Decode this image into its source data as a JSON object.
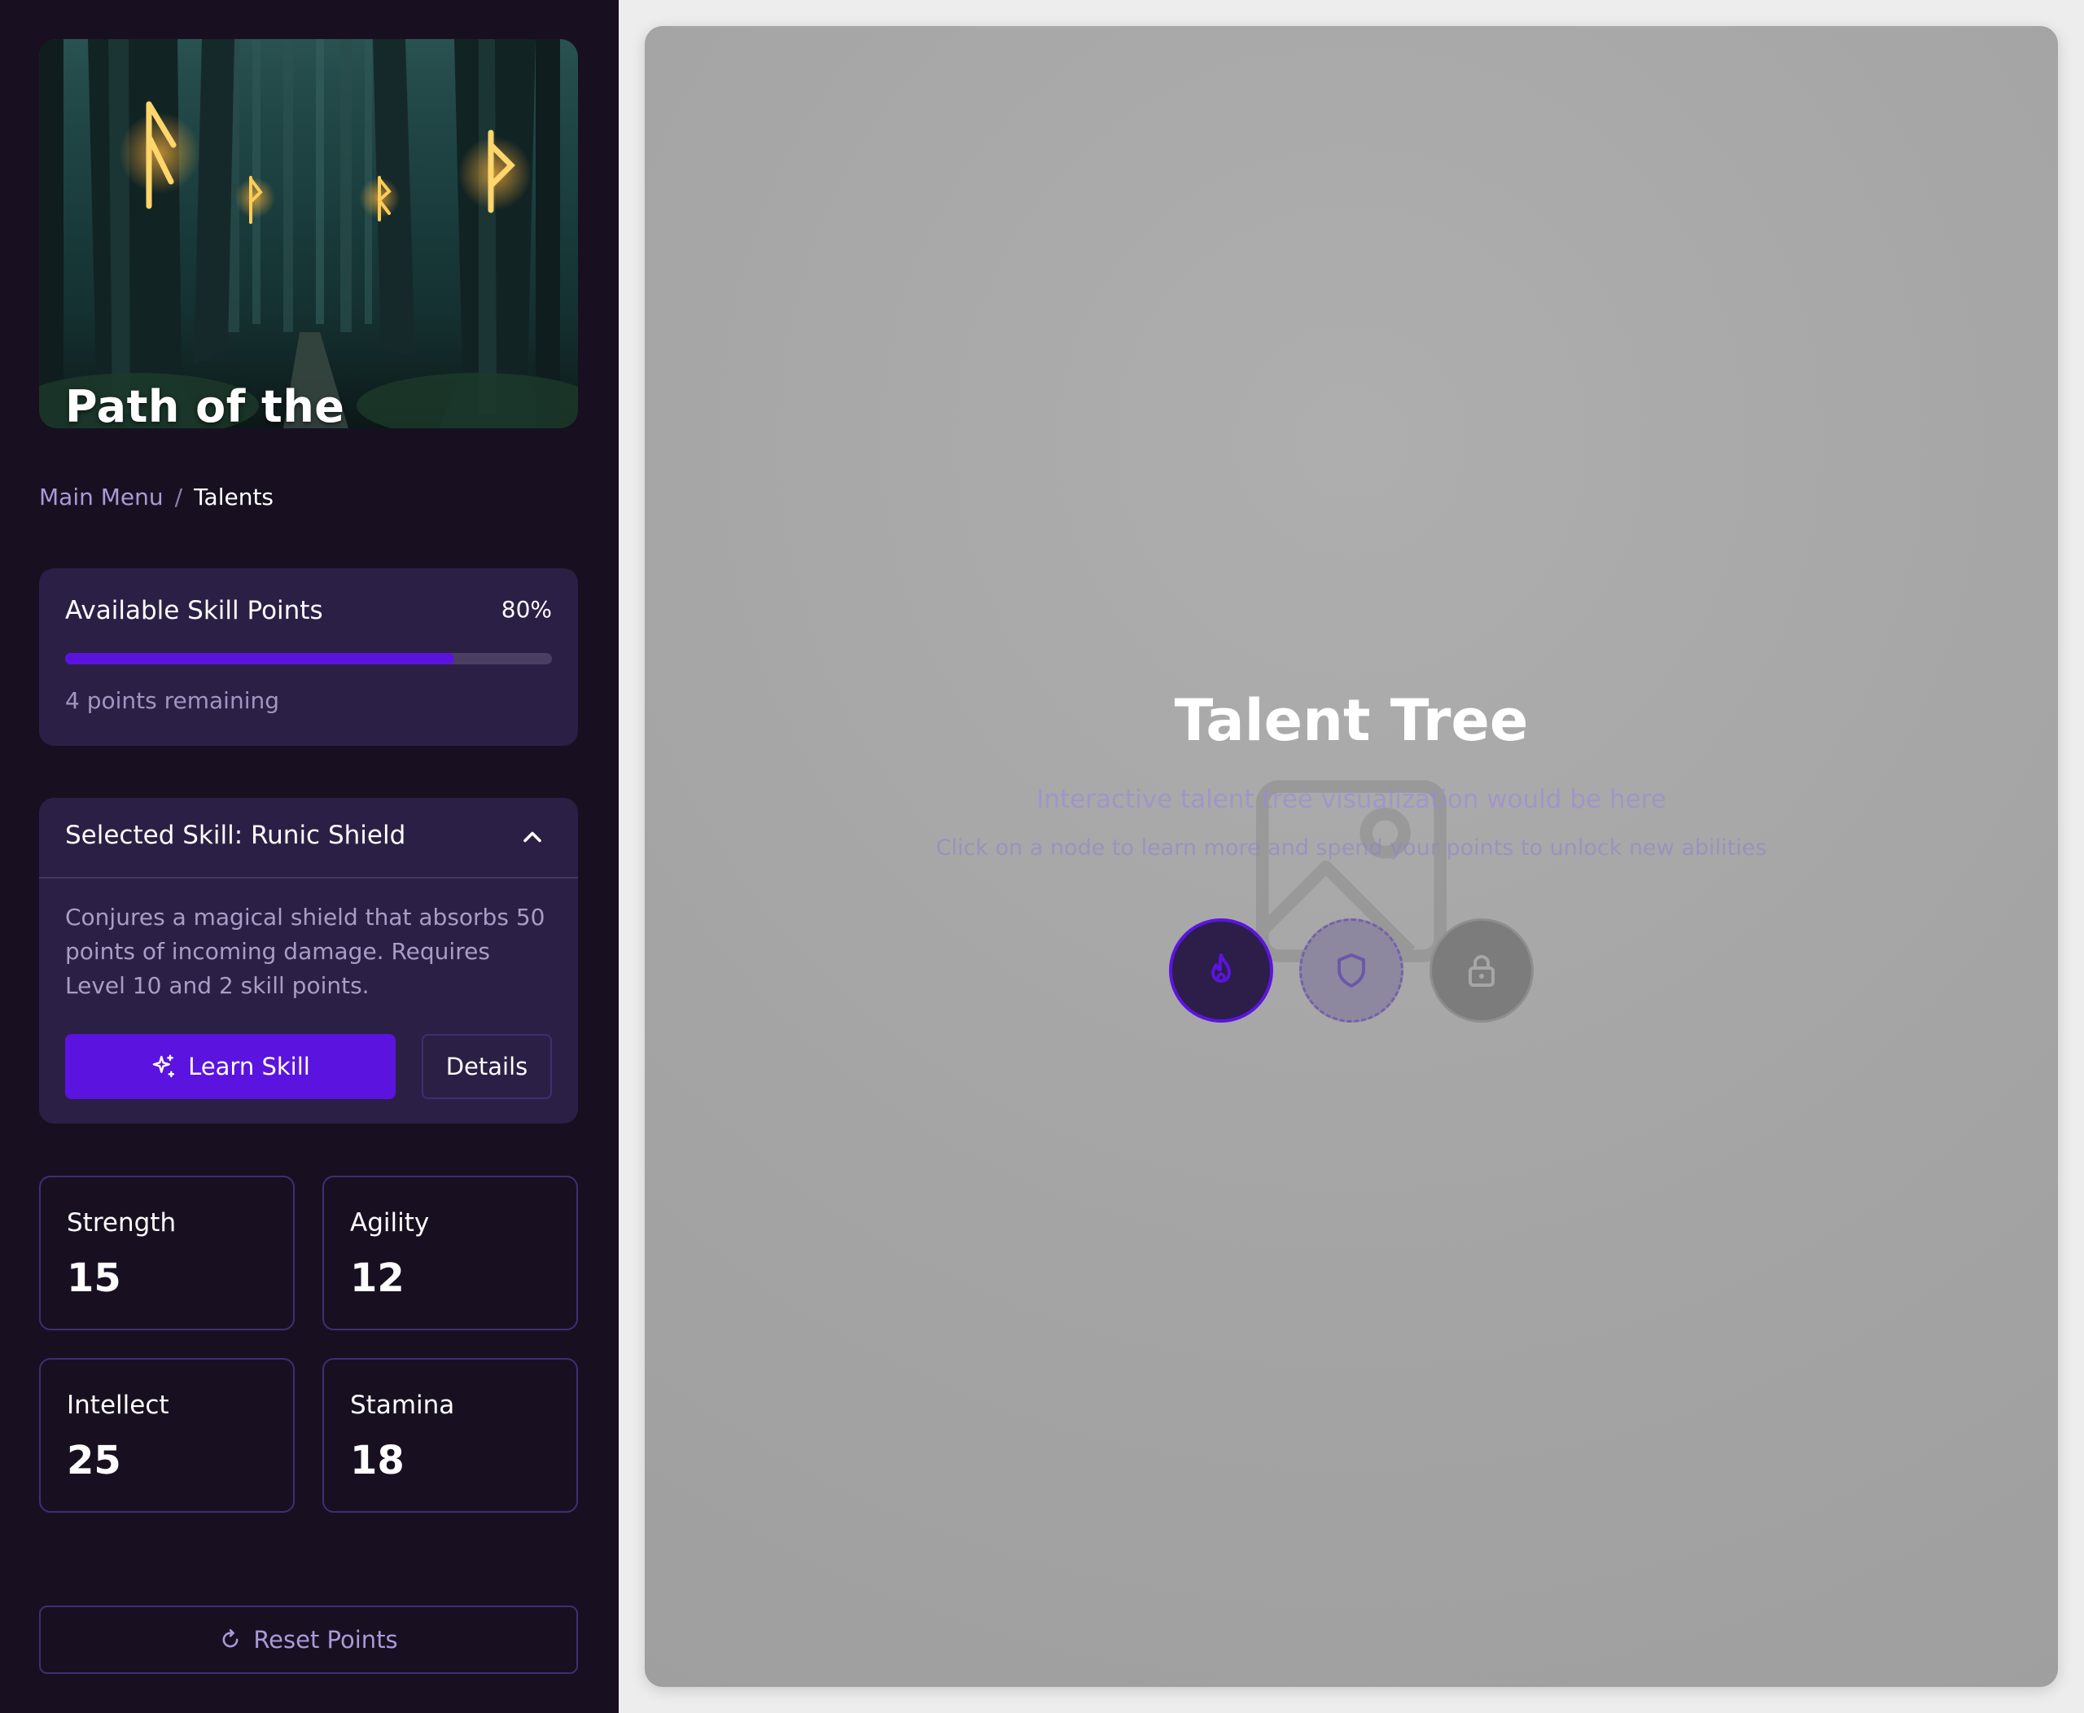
{
  "sidebar": {
    "hero_title": "Path of the Ancients",
    "breadcrumb": {
      "parent": "Main Menu",
      "separator": "/",
      "current": "Talents"
    },
    "skill_points": {
      "title": "Available Skill Points",
      "percent_label": "80%",
      "progress": 0.8,
      "remaining": "4 points remaining"
    },
    "selected_skill": {
      "title": "Selected Skill: Runic Shield",
      "description": "Conjures a magical shield that absorbs 50 points of incoming damage. Requires Level 10 and 2 skill points.",
      "learn_label": "Learn Skill",
      "details_label": "Details"
    },
    "stats": [
      {
        "label": "Strength",
        "value": "15"
      },
      {
        "label": "Agility",
        "value": "12"
      },
      {
        "label": "Intellect",
        "value": "25"
      },
      {
        "label": "Stamina",
        "value": "18"
      }
    ],
    "reset_label": "Reset Points"
  },
  "main": {
    "title": "Talent Tree",
    "subtitle": "Interactive talent tree visualization would be here",
    "hint": "Click on a node to learn more and spend your points to unlock new abilities",
    "nodes": [
      {
        "icon": "fire-icon",
        "state": "active"
      },
      {
        "icon": "shield-icon",
        "state": "available"
      },
      {
        "icon": "lock-icon",
        "state": "locked"
      }
    ]
  },
  "colors": {
    "sidebar_bg": "#181021",
    "card_bg": "#2c1f45",
    "accent": "#5b14df",
    "muted_text": "#a99ad8",
    "main_panel_bg": "#a6a6a6"
  }
}
